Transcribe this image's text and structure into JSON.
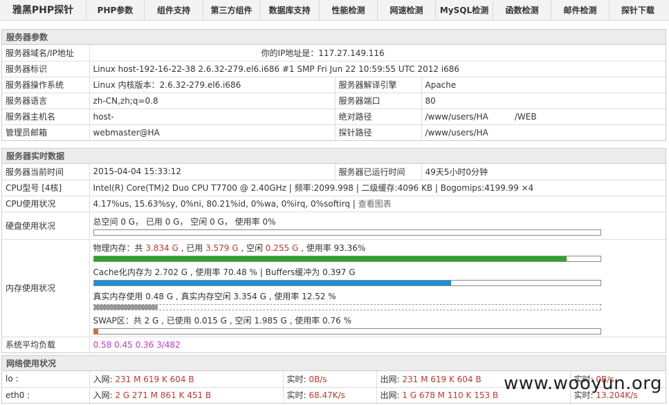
{
  "nav": {
    "brand": "雅黑PHP探针",
    "items": [
      "PHP参数",
      "组件支持",
      "第三方组件",
      "数据库支持",
      "性能检测",
      "网速检测",
      "MySQL检测",
      "函数检测",
      "邮件检测",
      "探针下载"
    ]
  },
  "server_params": {
    "title": "服务器参数",
    "domain_label": "服务器域名/IP地址",
    "domain_value": "你的IP地址是：117.27.149.116",
    "id_label": "服务器标识",
    "id_value": "Linux host-192-16-22-38 2.6.32-279.el6.i686 #1 SMP Fri Jun 22 10:59:55 UTC 2012 i686",
    "os_label": "服务器操作系统",
    "os_value": "Linux  内核版本：2.6.32-279.el6.i686",
    "engine_label": "服务器解译引擎",
    "engine_value": "Apache",
    "lang_label": "服务器语言",
    "lang_value": "zh-CN,zh;q=0.8",
    "port_label": "服务器端口",
    "port_value": "80",
    "host_label": "服务器主机名",
    "host_value": "host-",
    "abspath_label": "绝对路径",
    "abspath_value": "/www/users/HA          /WEB",
    "admin_label": "管理员邮箱",
    "admin_value": "webmaster@HA",
    "probe_label": "探针路径",
    "probe_value": "/www/users/HA"
  },
  "realtime": {
    "title": "服务器实时数据",
    "time_label": "服务器当前时间",
    "time_value": "2015-04-04 15:33:12",
    "uptime_label": "服务器已运行时间",
    "uptime_value": "49天5小时0分钟",
    "cpu_label": "CPU型号 [4核]",
    "cpu_value": "Intel(R) Core(TM)2 Duo CPU T7700 @ 2.40GHz | 频率:2099.998 | 二级缓存:4096 KB | Bogomips:4199.99 ×4",
    "cpu_usage_label": "CPU使用状况",
    "cpu_usage_value": "4.17%us, 15.63%sy, 0%ni, 80.21%id, 0%wa, 0%irq, 0%softirq | ",
    "cpu_usage_link": "查看图表",
    "disk_label": "硬盘使用状况",
    "disk_value": "总空间 0 G， 已用 0 G， 空闲 0 G， 使用率 0%",
    "disk_fraction": 0,
    "mem_label": "内存使用状况",
    "mem_phys_prefix": "物理内存：共 ",
    "mem_phys_total": "3.834 G",
    "mem_phys_mid1": " , 已用 ",
    "mem_phys_used": "3.579 G",
    "mem_phys_mid2": " , 空闲 ",
    "mem_phys_free": "0.255 G",
    "mem_phys_suffix": " , 使用率 93.36%",
    "mem_phys_fraction": 0.9336,
    "mem_cache_text": "Cache化内存为 2.702 G , 使用率 70.48 % | Buffers缓冲为 0.397 G",
    "mem_cache_fraction": 0.7048,
    "mem_real_text": "真实内存使用 0.48 G , 真实内存空闲 3.354 G , 使用率 12.52 %",
    "mem_real_fraction": 0.1252,
    "mem_swap_text": "SWAP区：共 2 G , 已使用 0.015 G , 空闲 1.985 G , 使用率 0.76 %",
    "mem_swap_fraction": 0.0076,
    "load_label": "系统平均负载",
    "load_value": "0.58 0.45 0.36 3/482",
    "colors": {
      "phys": "#2da52d",
      "cache": "#1b8fd8",
      "real": "#999999",
      "swap": "#e8692a"
    }
  },
  "network": {
    "title": "网络使用状况",
    "rows": [
      {
        "iface": "lo :",
        "in_label": "入网: ",
        "in_value": "231 M 619 K 604 B",
        "rt1_label": "实时: ",
        "rt1_value": "0B/s",
        "out_label": "出网: ",
        "out_value": "231 M 619 K 604 B",
        "rt2_label": "实时: ",
        "rt2_value": "0B/s"
      },
      {
        "iface": "eth0 :",
        "in_label": "入网: ",
        "in_value": "2 G 271 M 861 K 451 B",
        "rt1_label": "实时: ",
        "rt1_value": "68.47K/s",
        "out_label": "出网: ",
        "out_value": "1 G 678 M 110 K 153 B",
        "rt2_label": "实时: ",
        "rt2_value": "13.204K/s"
      }
    ]
  },
  "watermark": "www.wooyun.org"
}
